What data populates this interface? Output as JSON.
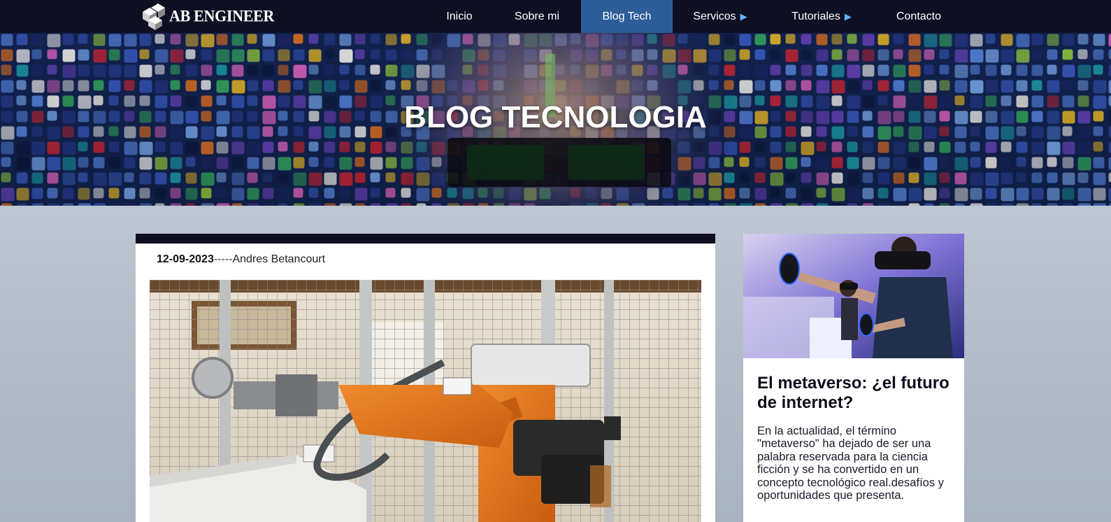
{
  "brand": {
    "name": "AB ENGINEER",
    "logo_icon": "stacked-cubes-icon"
  },
  "nav": {
    "items": [
      {
        "label": "Inicio"
      },
      {
        "label": "Sobre mi"
      },
      {
        "label": "Blog Tech",
        "active": true
      },
      {
        "label": "Servicos",
        "submenu_icon": "triangle-right-icon"
      },
      {
        "label": "Tutoriales",
        "submenu_icon": "triangle-right-icon"
      },
      {
        "label": "Contacto"
      }
    ],
    "submenu_arrow": "▶"
  },
  "hero": {
    "title": "BLOG TECNOLOGIA"
  },
  "post": {
    "date": "12-09-2023",
    "separator": "-----",
    "author": "Andres Betancourt",
    "image_subject": "orange industrial robot arm inside a wire mesh cell"
  },
  "sidebar": {
    "title": "El metaverso: ¿el futuro de internet?",
    "excerpt": "En la actualidad, el término \"metaverso\" ha dejado de ser una palabra reservada para la ciencia ficción y se ha convertido en un concepto tecnológico real.desafíos y oportunidades que presenta.",
    "image_subject": "man using a VR headset and controllers"
  },
  "colors": {
    "navbar": "#0f0f22",
    "active_tab": "#2d5d99",
    "accent_arrow": "#5ab4ff",
    "robot_orange": "#e8731b"
  }
}
